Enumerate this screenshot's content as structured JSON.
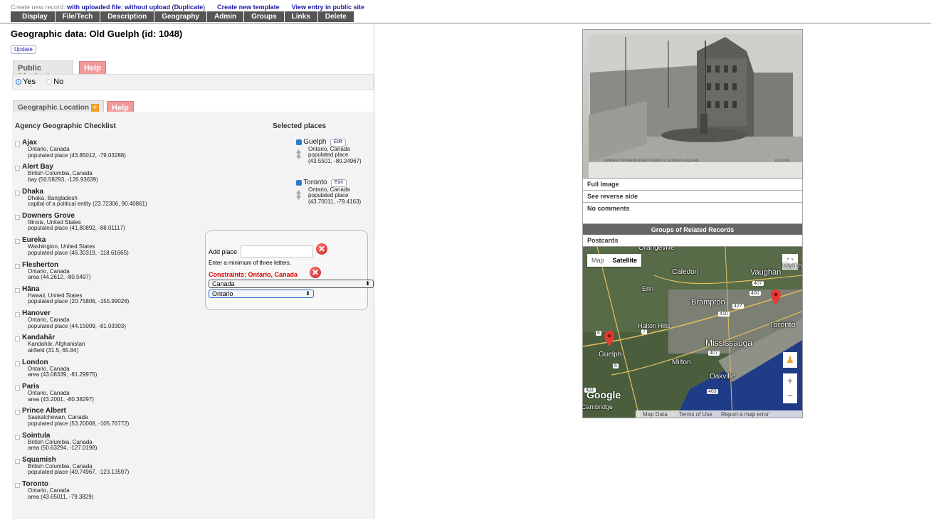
{
  "toolbar": {
    "create_label": "Create new record:",
    "with_upload": "with uploaded file",
    "without_upload": "without upload",
    "duplicate": "Duplicate",
    "new_template": "Create new template",
    "view_public": "View entry in public site",
    "tabs": [
      "Display",
      "File/Tech",
      "Description",
      "Geography",
      "Admin",
      "Groups",
      "Links",
      "Delete"
    ]
  },
  "page": {
    "title": "Geographic data: Old Guelph (id: 1048)",
    "update_label": "Update"
  },
  "public_display": {
    "label": "Public Display?",
    "help": "Help",
    "yes": "Yes",
    "no": "No",
    "selected": "Yes"
  },
  "geo": {
    "tab_label": "Geographic Location",
    "help": "Help",
    "checklist_title": "Agency Geographic Checklist",
    "selected_title": "Selected places",
    "places": [
      {
        "name": "Ajax",
        "region": "Ontario, Canada",
        "info": "populated place (43.85012, -79.03288)"
      },
      {
        "name": "Alert Bay",
        "region": "British Columbia, Canada",
        "info": "bay (50.58293, -126.93639)"
      },
      {
        "name": "Dhaka",
        "region": "Dhaka, Bangladesh",
        "info": "capital of a political entity (23.72306, 90.40861)"
      },
      {
        "name": "Downers Grove",
        "region": "Illinois, United States",
        "info": "populated place (41.80892, -88.01117)"
      },
      {
        "name": "Eureka",
        "region": "Washington, United States",
        "info": "populated place (46.30319, -118.61665)"
      },
      {
        "name": "Flesherton",
        "region": "Ontario, Canada",
        "info": "area (44.2612, -80.5497)"
      },
      {
        "name": "Hāna",
        "region": "Hawaii, United States",
        "info": "populated place (20.75806, -155.99028)"
      },
      {
        "name": "Hanover",
        "region": "Ontario, Canada",
        "info": "populated place (44.15009, -81.03303)"
      },
      {
        "name": "Kandahār",
        "region": "Kandahār, Afghanistan",
        "info": "airfield (31.5, 65.84)"
      },
      {
        "name": "London",
        "region": "Ontario, Canada",
        "info": "area (43.08339, -81.29975)"
      },
      {
        "name": "Paris",
        "region": "Ontario, Canada",
        "info": "area (43.2001, -80.38297)"
      },
      {
        "name": "Prince Albert",
        "region": "Saskatchewan, Canada",
        "info": "populated place (53.20008, -105.76772)"
      },
      {
        "name": "Sointula",
        "region": "British Columbia, Canada",
        "info": "area (50.63294, -127.0198)"
      },
      {
        "name": "Squamish",
        "region": "British Columbia, Canada",
        "info": "populated place (49.74967, -123.13597)"
      },
      {
        "name": "Toronto",
        "region": "Ontario, Canada",
        "info": "area (43.65011, -79.3829)"
      }
    ],
    "selected": [
      {
        "name": "Guelph",
        "edit": "Edit",
        "region": "Ontario, Canada",
        "type": "populated place",
        "coords": "(43.5501, -80.24967)"
      },
      {
        "name": "Toronto",
        "edit": "Edit",
        "region": "Ontario, Canada",
        "type": "populated place",
        "coords": "(43.70011, -79.4163)"
      }
    ],
    "add_place_label": "Add place",
    "add_place_value": "",
    "hint": "Enter a minimum of three letters.",
    "constraints": "Constraints: Ontario, Canada",
    "country": "Canada",
    "province": "Ontario"
  },
  "record": {
    "caption": "UPPER WYNDHAM STREET FROM ST. GEORGE'S SQUARE",
    "caption_city": "GUELPH",
    "full_image": "Full Image",
    "reverse": "See reverse side",
    "comments": "No comments",
    "groups_header": "Groups of Related Records",
    "group": "Postcards"
  },
  "map": {
    "map_btn": "Map",
    "satellite_btn": "Satellite",
    "labels": [
      "Orangeville",
      "Caledon",
      "Vaughan",
      "Markham",
      "Erin",
      "Brampton",
      "Halton Hills",
      "Toronto",
      "Mississauga",
      "Guelph",
      "Milton",
      "Oakville",
      "Cambridge"
    ],
    "road_badges": [
      "407",
      "400",
      "427",
      "410",
      "7",
      "6",
      "6",
      "401",
      "407",
      "403"
    ],
    "footer": [
      "Map Data",
      "Terms of Use",
      "Report a map error"
    ],
    "logo": "Google"
  }
}
